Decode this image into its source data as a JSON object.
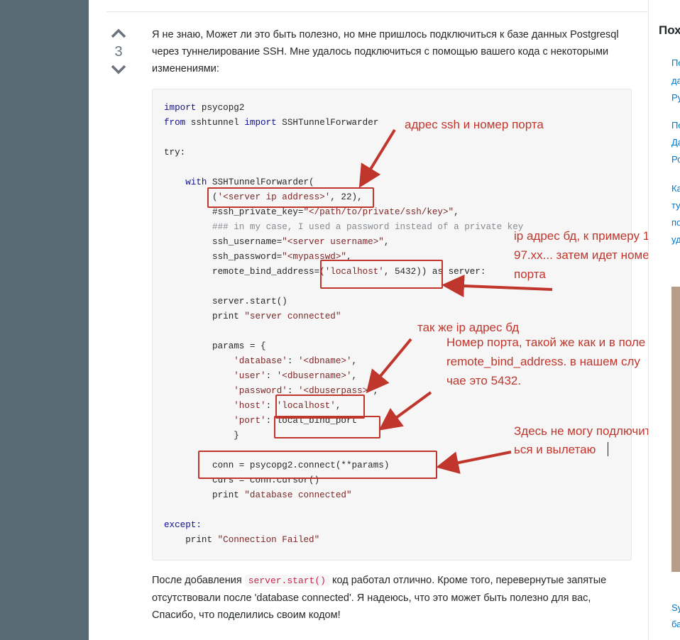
{
  "vote": {
    "count": "3"
  },
  "answer": {
    "intro": "Я не знаю, Может ли это быть полезно, но мне пришлось подключиться к базе данных Postgresql через туннелирование SSH. Мне удалось подключиться с помощью вашего кода с некоторыми изменениями:",
    "after_prefix": "После добавления ",
    "after_code": "server.start()",
    "after_suffix": " код работал отлично. Кроме того, перевернутые запятые отсутствовали после 'database connected'. Я надеюсь, что это может быть полезно для вас, Спасибо, что поделились своим кодом!"
  },
  "code": {
    "l1a": "import",
    "l1b": " psycopg2",
    "l2a": "from",
    "l2b": " sshtunnel ",
    "l2c": "import",
    "l2d": " SSHTunnelForwarder",
    "l4": "try:",
    "l6a": "    with",
    "l6b": " SSHTunnelForwarder(",
    "l7a": "         (",
    "l7b": "'<server ip address>'",
    "l7c": ", 22),",
    "l8a": "         #ssh_private_key=",
    "l8b": "\"</path/to/private/ssh/key>\"",
    "l8c": ",",
    "l9": "         ### in my case, I used a password instead of a private key",
    "l10a": "         ssh_username=",
    "l10b": "\"<server username>\"",
    "l10c": ",",
    "l11a": "         ssh_password=",
    "l11b": "\"<mypasswd>\"",
    "l11c": ",",
    "l12a": "         remote_bind_address=(",
    "l12b": "'localhost'",
    "l12c": ", 5432)) as server:",
    "l14": "         server.start()",
    "l15a": "         print ",
    "l15b": "\"server connected\"",
    "l17": "         params = {",
    "l18a": "             ",
    "l18b": "'database'",
    "l18c": ": ",
    "l18d": "'<dbname>'",
    "l18e": ",",
    "l19a": "             ",
    "l19b": "'user'",
    "l19c": ": ",
    "l19d": "'<dbusername>'",
    "l19e": ",",
    "l20a": "             ",
    "l20b": "'password'",
    "l20c": ": ",
    "l20d": "'<dbuserpass>'",
    "l20e": ",",
    "l21a": "             ",
    "l21b": "'host'",
    "l21c": ": ",
    "l21d": "'localhost'",
    "l21e": ",",
    "l22a": "             ",
    "l22b": "'port'",
    "l22c": ": local_bind_port",
    "l23": "             }",
    "l25": "         conn = psycopg2.connect(**params)",
    "l26": "         curs = conn.cursor()",
    "l27a": "         print ",
    "l27b": "\"database connected\"",
    "l29": "except:",
    "l30a": "    print ",
    "l30b": "\"Connection Failed\""
  },
  "annotations": {
    "a1": "адрес ssh и номер порта",
    "a2_1": "ip адрес бд, к примеру 1",
    "a2_2": "97.xx... затем идет номер",
    "a2_3": "порта",
    "a3": "так же ip адрес бд",
    "a4_1": "Номер порта, такой же как и в поле",
    "a4_2": "remote_bind_address. в нашем слу",
    "a4_3": "чае это 5432.",
    "a5_1": "Здесь не могу подлючит",
    "a5_2": "ься и вылетаю"
  },
  "sidebar": {
    "title": "Пох",
    "links": [
      "По",
      "да",
      "Ру",
      "По",
      "Да",
      "Ро",
      "Ка",
      "ту",
      "по",
      "уд",
      "Sy",
      "ба"
    ]
  },
  "colors": {
    "annotation": "#c0362c",
    "rail": "#5a6b76",
    "link": "#0077cc"
  }
}
